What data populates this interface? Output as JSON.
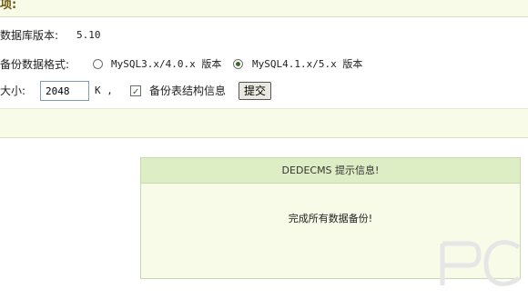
{
  "header": {
    "title_fragment": "项:"
  },
  "db_version": {
    "label": "数据库版本:",
    "value": "5.10"
  },
  "backup_format": {
    "label": "备份数据格式:",
    "options": [
      {
        "label": "MySQL3.x/4.0.x 版本",
        "selected": false
      },
      {
        "label": "MySQL4.1.x/5.x 版本",
        "selected": true
      }
    ]
  },
  "size": {
    "label": "大小:",
    "value": "2048",
    "unit": "K ,",
    "checkbox_label": "备份表结构信息",
    "checkbox_checked": true,
    "submit_label": "提交"
  },
  "message": {
    "title": "DEDECMS 提示信息!",
    "body": "完成所有数据备份!"
  },
  "colors": {
    "band_bg": "#f9fbe9",
    "header_bg": "#ddeec4",
    "border": "#c5dab1"
  }
}
